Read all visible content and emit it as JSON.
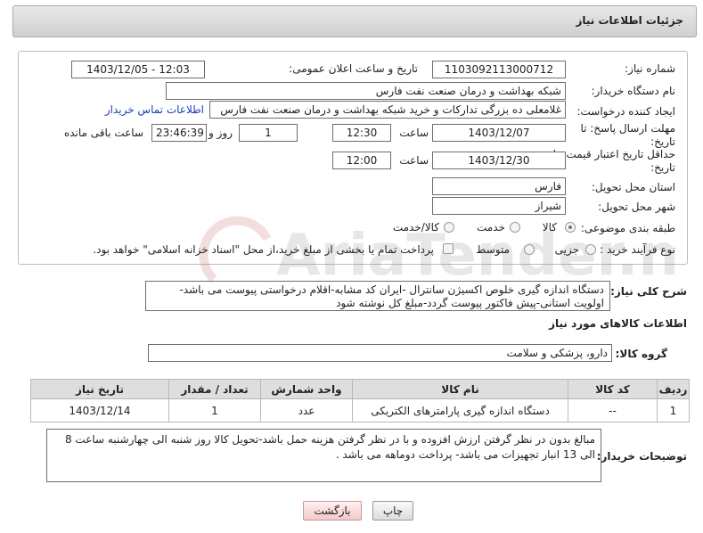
{
  "header": {
    "title": "جزئیات اطلاعات نیاز"
  },
  "form": {
    "need_number_label": "شماره نیاز:",
    "need_number": "1103092113000712",
    "announce_label": "تاریخ و ساعت اعلان عمومی:",
    "announce_value": "1403/12/05 - 12:03",
    "buyer_org_label": "نام دستگاه خریدار:",
    "buyer_org": "شبکه بهداشت و درمان صنعت نفت فارس",
    "creator_label": "ایجاد کننده درخواست:",
    "creator": "غلامعلی ده بزرگی تدارکات و خرید شبکه بهداشت و درمان صنعت نفت فارس",
    "contact_link": "اطلاعات تماس خریدار",
    "deadline_label_line1": "مهلت ارسال پاسخ: تا",
    "deadline_label_line2": "تاریخ:",
    "deadline_date": "1403/12/07",
    "time_label": "ساعت",
    "deadline_time": "12:30",
    "days_value": "1",
    "days_and_label": "روز و",
    "remaining_value": "23:46:39",
    "remaining_label": "ساعت باقی مانده",
    "validity_label_line1": "حداقل تاریخ اعتبار قیمت: تا",
    "validity_label_line2": "تاریخ:",
    "validity_date": "1403/12/30",
    "validity_time": "12:00",
    "province_label": "استان محل تحویل:",
    "province": "فارس",
    "city_label": "شهر محل تحویل:",
    "city": "شیراز",
    "category_label": "طبقه بندی موضوعی:",
    "category_options": [
      "کالا",
      "خدمت",
      "کالا/خدمت"
    ],
    "category_selected": "کالا",
    "purchase_type_label": "نوع فرآیند خرید :",
    "purchase_options": [
      "جزیی",
      "متوسط"
    ],
    "payment_note": "پرداخت تمام یا بخشی از مبلغ خرید،از محل \"اسناد خزانه اسلامی\" خواهد بود."
  },
  "description": {
    "label": "شرح کلی نیاز:",
    "text": "دستگاه اندازه گیری خلوص اکسیژن سانترال -ایران کد مشابه-اقلام درخواستی پیوست می باشد-اولویت استانی-پیش فاکتور پیوست گردد-مبلغ کل نوشته شود"
  },
  "goods": {
    "section_title": "اطلاعات کالاهای مورد نیاز",
    "group_label": "گروه کالا:",
    "group_value": "دارو، پزشکی و سلامت",
    "columns": [
      "ردیف",
      "کد کالا",
      "نام کالا",
      "واحد شمارش",
      "تعداد / مقدار",
      "تاریخ نیاز"
    ],
    "rows": [
      {
        "row": "1",
        "code": "--",
        "name": "دستگاه اندازه گیری پارامترهای الکتریکی",
        "unit": "عدد",
        "qty": "1",
        "date": "1403/12/14"
      }
    ]
  },
  "buyer_notes": {
    "label": "توضیحات خریدار:",
    "text": "مبالغ بدون در نظر گرفتن ارزش افزوده و با در نظر گرفتن هزینه حمل باشد-تحویل کالا روز شنبه الی چهارشنبه ساعت 8 الی 13 انبار تجهیزات می باشد- پرداخت دوماهه می باشد ."
  },
  "buttons": {
    "print": "چاپ",
    "back": "بازگشت"
  },
  "watermark_text": "AriaTender.neT",
  "colors": {
    "link": "#1a3fb5",
    "header_bg": "#d8d8d8",
    "back_button": "#f6d6d6"
  }
}
